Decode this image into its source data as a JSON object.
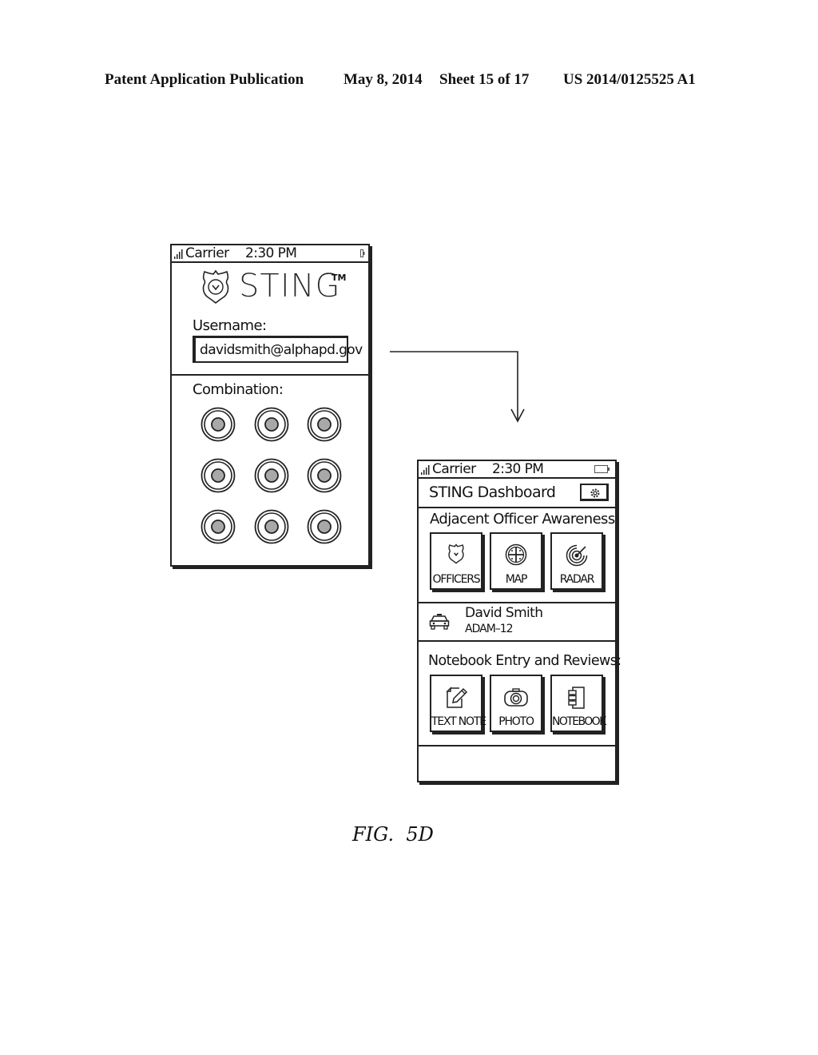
{
  "page_header": {
    "publication": "Patent Application Publication",
    "date": "May 8, 2014",
    "sheet": "Sheet 15 of 17",
    "number": "US 2014/0125525 A1"
  },
  "figure_caption": "FIG.  5D",
  "login_screen": {
    "status_bar": {
      "carrier": "Carrier",
      "time": "2:30  PM"
    },
    "logo": {
      "icon": "shield-badge-icon",
      "text": "STING",
      "trademark": "TM"
    },
    "username_label": "Username:",
    "username_value": "davidsmith@alphapd.gov",
    "combination_label": "Combination:",
    "combination_dials": 9
  },
  "dashboard_screen": {
    "status_bar": {
      "carrier": "Carrier",
      "time": "2:30  PM"
    },
    "title": "STING Dashboard",
    "settings_icon": "gear-icon",
    "awareness_section": {
      "heading": "Adjacent  Officer  Awareness",
      "tiles": [
        {
          "label": "OFFICERS",
          "icon": "shield-badge-icon"
        },
        {
          "label": "MAP",
          "icon": "map-wheel-icon"
        },
        {
          "label": "RADAR",
          "icon": "radar-icon"
        }
      ]
    },
    "officer": {
      "icon": "police-car-icon",
      "name": "David  Smith",
      "unit": "ADAM–12"
    },
    "notebook_section": {
      "heading": "Notebook  Entry  and  Reviews:",
      "tiles": [
        {
          "label": "TEXT  NOTE",
          "icon": "pencil-note-icon"
        },
        {
          "label": "PHOTO",
          "icon": "camera-icon"
        },
        {
          "label": "NOTEBOOK",
          "icon": "notebook-icon"
        }
      ]
    }
  },
  "flow_arrow": {
    "from": "login_screen",
    "to": "dashboard_screen"
  }
}
